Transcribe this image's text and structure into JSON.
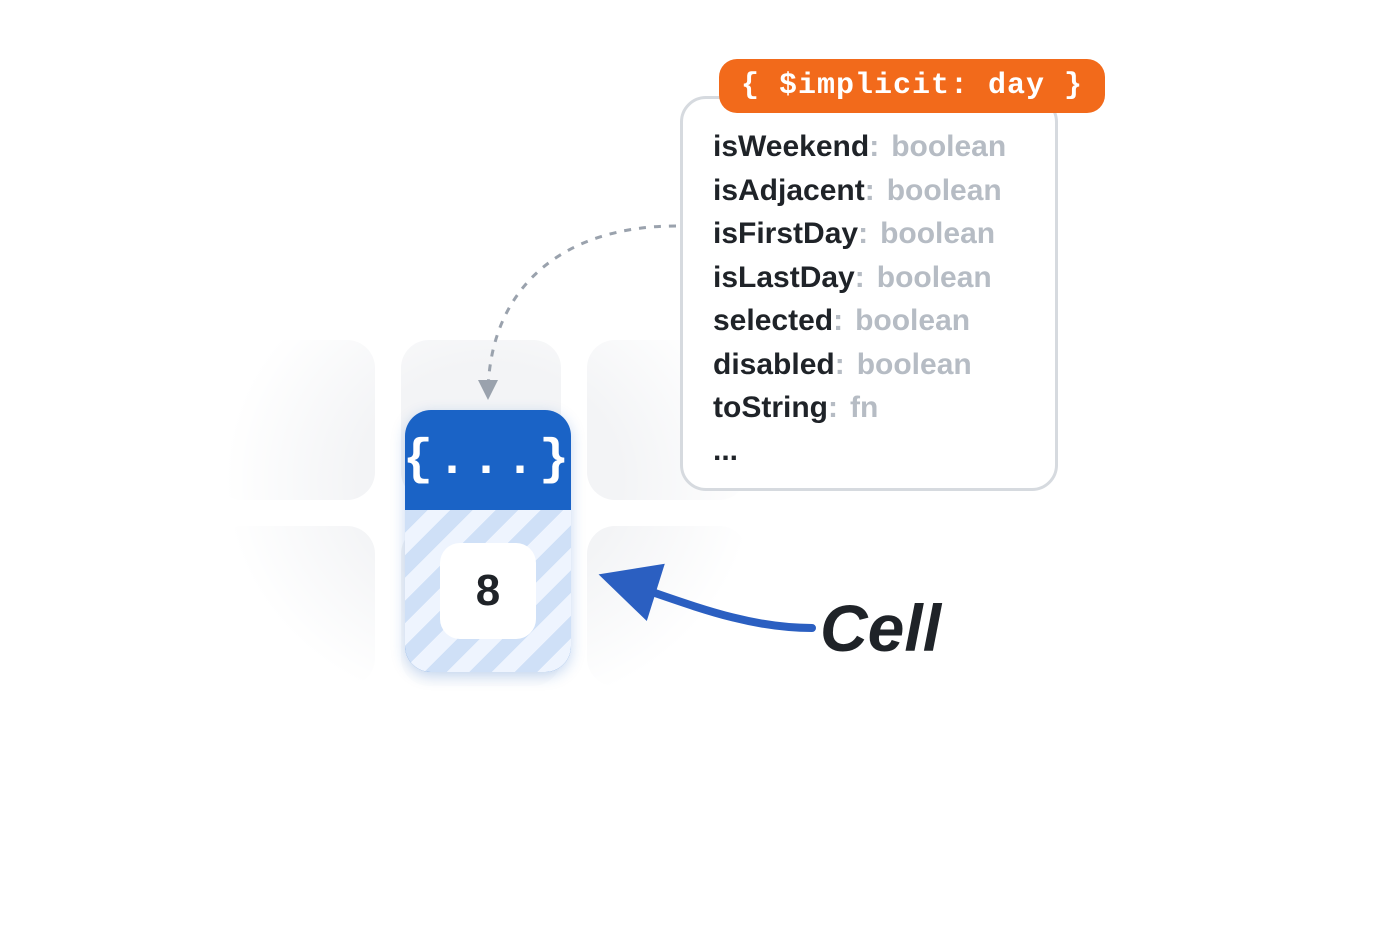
{
  "colors": {
    "brand_blue": "#1a63c6",
    "badge_orange": "#f26a1b",
    "muted": "#b6bcc4",
    "border": "#d6dadf"
  },
  "hero_cell": {
    "context_glyph": "{...}",
    "day_value": "8"
  },
  "context_card": {
    "badge": "{ $implicit: day }",
    "properties": [
      {
        "key": "isWeekend",
        "type": "boolean"
      },
      {
        "key": "isAdjacent",
        "type": "boolean"
      },
      {
        "key": "isFirstDay",
        "type": "boolean"
      },
      {
        "key": "isLastDay",
        "type": "boolean"
      },
      {
        "key": "selected",
        "type": "boolean"
      },
      {
        "key": "disabled",
        "type": "boolean"
      },
      {
        "key": "toString",
        "type": "fn"
      }
    ],
    "ellipsis": "..."
  },
  "labels": {
    "cell": "Cell"
  }
}
